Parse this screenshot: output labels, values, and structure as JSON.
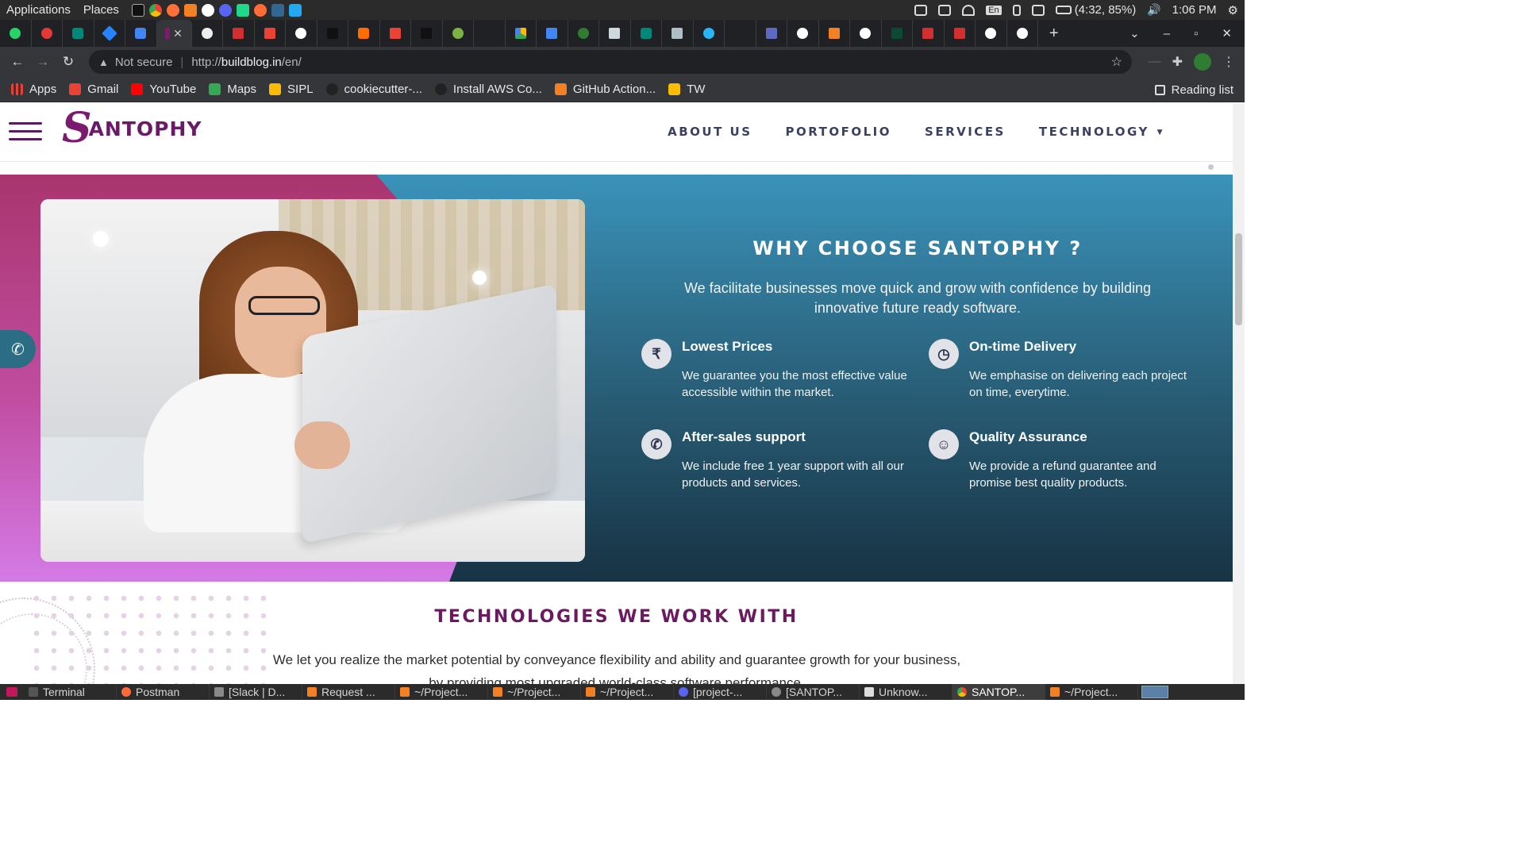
{
  "os_panel": {
    "menus": [
      "Applications",
      "Places"
    ],
    "battery": "(4:32, 85%)",
    "time": "1:06 PM",
    "lang": "En"
  },
  "browser": {
    "omnibox": {
      "security": "Not secure",
      "url_prefix": "http://",
      "url_host": "buildblog.in",
      "url_path": "/en/"
    },
    "bookmarks": [
      {
        "label": "Apps",
        "color": "#e94235"
      },
      {
        "label": "Gmail",
        "color": "#ea4335"
      },
      {
        "label": "YouTube",
        "color": "#ff0000"
      },
      {
        "label": "Maps",
        "color": "#34a853"
      },
      {
        "label": "SIPL",
        "color": "#fbbc05"
      },
      {
        "label": "cookiecutter-...",
        "color": "#222222"
      },
      {
        "label": "Install AWS Co...",
        "color": "#222222"
      },
      {
        "label": "GitHub Action...",
        "color": "#f48024"
      },
      {
        "label": "TW",
        "color": "#fbbc05"
      }
    ],
    "reading_list": "Reading list"
  },
  "site": {
    "logo_initial": "S",
    "logo_rest": "ANTOPHY",
    "nav": [
      "ABOUT US",
      "PORTOFOLIO",
      "SERVICES",
      "TECHNOLOGY"
    ],
    "why": {
      "title": "WHY CHOOSE SANTOPHY ?",
      "subtitle": "We facilitate businesses move quick and grow with confidence by building innovative future ready software.",
      "features": [
        {
          "icon": "rupee-icon",
          "glyph": "₹",
          "title": "Lowest Prices",
          "desc": "We guarantee you the most effective value accessible within the market."
        },
        {
          "icon": "clock-icon",
          "glyph": "◷",
          "title": "On-time Delivery",
          "desc": "We emphasise on delivering each project on time, everytime."
        },
        {
          "icon": "phone-icon",
          "glyph": "✆",
          "title": "After-sales support",
          "desc": "We include free 1 year support with all our products and services."
        },
        {
          "icon": "smile-icon",
          "glyph": "☺",
          "title": "Quality Assurance",
          "desc": "We provide a refund guarantee and promise best quality products."
        }
      ]
    },
    "tech": {
      "title": "TECHNOLOGIES WE WORK WITH",
      "subtitle": "We let you realize the market potential by conveyance flexibility and ability and guarantee growth for your business, by providing most upgraded world-class software performance."
    }
  },
  "taskbar": [
    {
      "label": "Terminal",
      "color": "#555555"
    },
    {
      "label": "Postman",
      "color": "#ff6c37"
    },
    {
      "label": "[Slack | D...",
      "color": "#888888"
    },
    {
      "label": "Request ...",
      "color": "#f48024"
    },
    {
      "label": "~/Project...",
      "color": "#f48024"
    },
    {
      "label": "~/Project...",
      "color": "#f48024"
    },
    {
      "label": "~/Project...",
      "color": "#f48024"
    },
    {
      "label": "[project-...",
      "color": "#5865f2"
    },
    {
      "label": "[SANTOP...",
      "color": "#888888"
    },
    {
      "label": "Unknow...",
      "color": "#dddddd"
    },
    {
      "label": "SANTOP...",
      "color": "#4285f4"
    },
    {
      "label": "~/Project...",
      "color": "#f48024"
    }
  ]
}
